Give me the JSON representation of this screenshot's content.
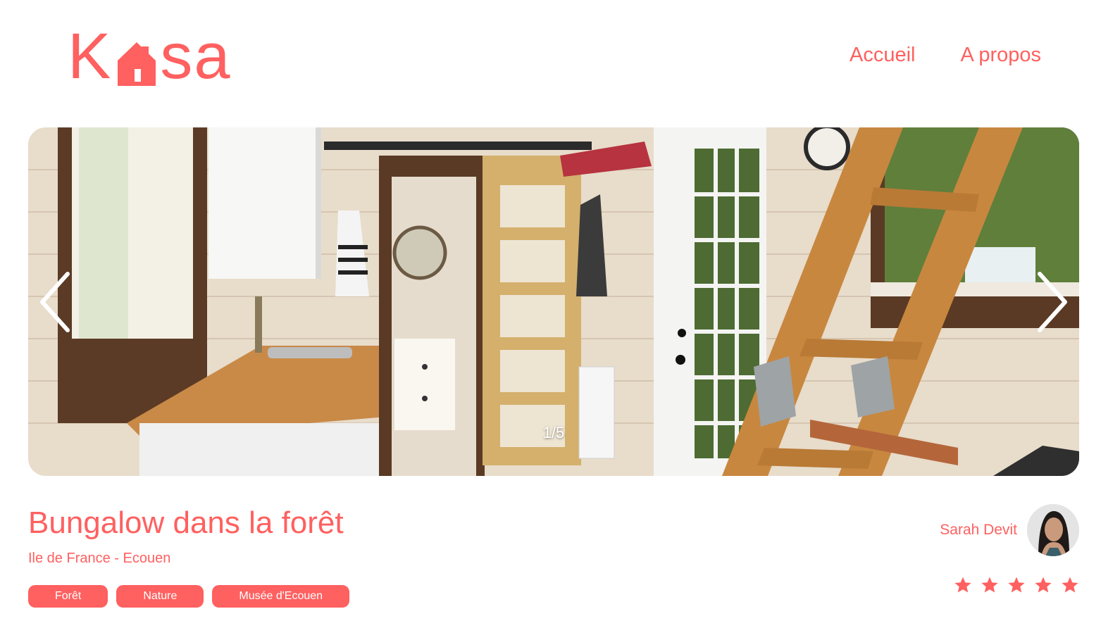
{
  "brand": {
    "letters_before": "K",
    "letters_after": "sa",
    "color": "#FF6060"
  },
  "nav": {
    "items": [
      {
        "label": "Accueil"
      },
      {
        "label": "A propos"
      }
    ]
  },
  "gallery": {
    "counter": "1/5",
    "current": 1,
    "total": 5,
    "prev_icon": "chevron-left-icon",
    "next_icon": "chevron-right-icon"
  },
  "listing": {
    "title": "Bungalow dans la forêt",
    "location": "Ile de France - Ecouen",
    "tags": [
      "Forêt",
      "Nature",
      "Musée d'Ecouen"
    ]
  },
  "host": {
    "name": "Sarah Devit"
  },
  "rating": {
    "value": 5,
    "max": 5,
    "active_color": "#FF6060"
  }
}
